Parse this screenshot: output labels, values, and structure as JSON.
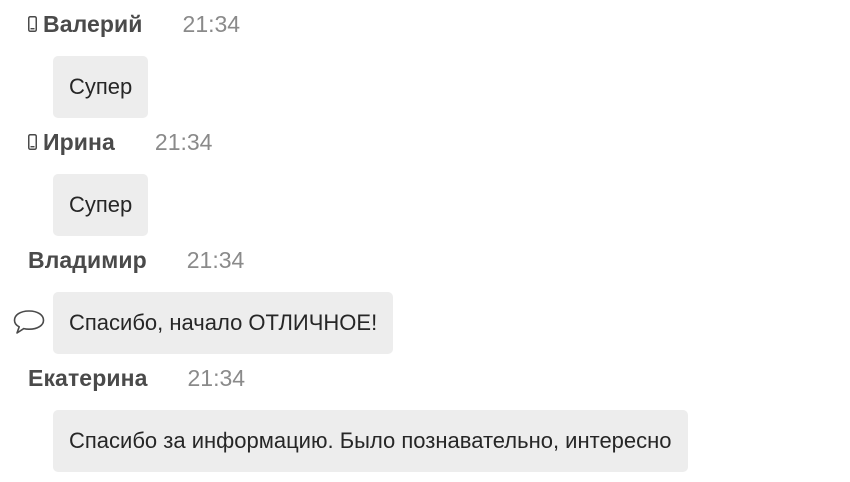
{
  "messages": [
    {
      "author": "Валерий",
      "time": "21:34",
      "text": "Супер",
      "mobile": true,
      "reply_icon": false
    },
    {
      "author": "Ирина",
      "time": "21:34",
      "text": "Супер",
      "mobile": true,
      "reply_icon": false
    },
    {
      "author": "Владимир",
      "time": "21:34",
      "text": "Спасибо, начало ОТЛИЧНОЕ!",
      "mobile": false,
      "reply_icon": true
    },
    {
      "author": "Екатерина",
      "time": "21:34",
      "text": "Спасибо за информацию. Было познавательно, интересно",
      "mobile": false,
      "reply_icon": false
    }
  ],
  "icons": {
    "mobile": "mobile-phone-icon",
    "reply": "speech-bubble-icon"
  },
  "colors": {
    "bubble_background": "#ededed",
    "author_text": "#4a4a4a",
    "time_text": "#8a8a8a",
    "message_text": "#262626"
  }
}
